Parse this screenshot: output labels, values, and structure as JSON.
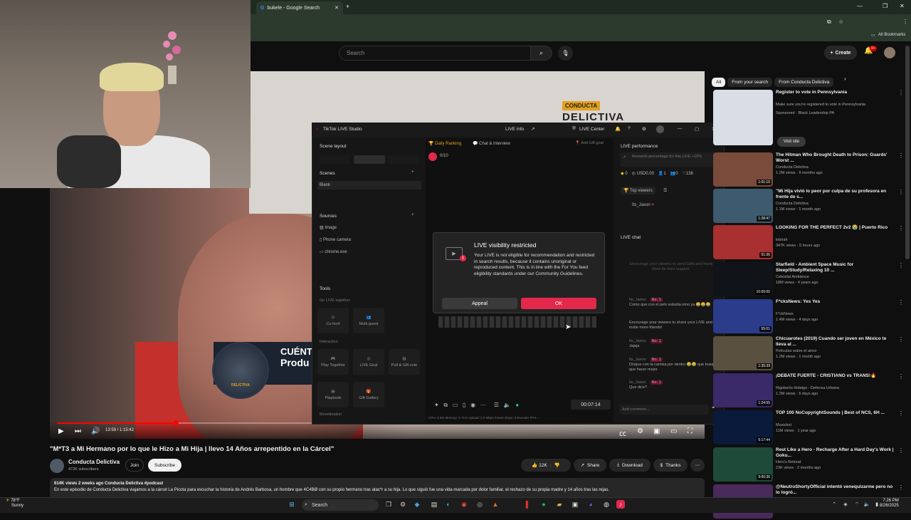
{
  "browser": {
    "tab_title": "bukele - Google Search",
    "bookmarks_label": "All Bookmarks"
  },
  "youtube": {
    "search_placeholder": "Search",
    "create_label": "Create",
    "notif_count": "9+",
    "video": {
      "time": "13:59 / 1:15:42",
      "progress_fraction": 0.185,
      "logo_top": "CONDUCTA",
      "logo_main": "DELICTIVA",
      "lower_third_1": "CUÉNT",
      "lower_third_2": "Produ",
      "badge": "DELICTIVA"
    },
    "title": "\"M*T3 a Mi Hermano por lo que le Hizo a Mi Hija | llevo 14 Años arrepentido en la Cárcel\"",
    "channel": {
      "name": "Conducta Delictiva",
      "subs": "472K subscribers"
    },
    "join_label": "Join",
    "subscribe_label": "Subscribe",
    "actions": {
      "likes": "12K",
      "share": "Share",
      "download": "Download",
      "thanks": "Thanks"
    },
    "description": {
      "meta": "614K views  2 weeks ago  Conducta Delictiva #podcast",
      "text": "En este episodio de Conducta Delictiva viajamos a la cárcel La Picota para escuchar la historia de Andrés Barbosa, un hombre que 4C4BØ con su propio hermano tras atac*r a su hija. Lo que siguió fue una vida marcada por dolor familiar, el rechazo de su propia madre y 14 años tras las rejas."
    },
    "chips": [
      "All",
      "From your search",
      "From Conducta Delictiva"
    ],
    "recommendations": [
      {
        "title": "Register to vote in Pennsylvania",
        "channel": "Make sure you're registered to vote in Pennsylvania",
        "meta": "Sponsored · Black Leadership PA",
        "duration": "",
        "cta": "Visit site",
        "color": "#d8dde6"
      },
      {
        "title": "The Hitman Who Brought Death to Prison: Guards' Worst ...",
        "channel": "Conducta Delictiva",
        "meta": "1.2M views · 9 months ago",
        "duration": "1:01:16",
        "color": "#7a4a3a"
      },
      {
        "title": "\"Mi Hija vivió lo peor por culpa de su profesora en frente de s...",
        "channel": "Conducta Delictiva",
        "meta": "1.1M views · 1 month ago",
        "duration": "1:28:47",
        "color": "#3d5a6e"
      },
      {
        "title": "LOOKING FOR THE PERFECT 2v2 😭 | Puerto Rico",
        "channel": "lebriah",
        "meta": "347K views · 5 hours ago",
        "duration": "51:36",
        "color": "#a83030"
      },
      {
        "title": "Starfield - Ambient Space Music for Sleep/Study/Relaxing 10 ...",
        "channel": "Celestial Ambience",
        "meta": "18M views · 4 years ago",
        "duration": "10:00:00",
        "color": "#101418"
      },
      {
        "title": "F*cksNews: Yes Yes",
        "channel": "F*ckNews",
        "meta": "1.4M views · 4 days ago",
        "duration": "55:01",
        "color": "#2a3c8a"
      },
      {
        "title": "Chicuarotes (2019)  Cuando ser joven en México te lleva al ...",
        "channel": "Películas sobre el amor",
        "meta": "1.2M views · 1 month ago",
        "duration": "1:35:39",
        "color": "#5a5040"
      },
      {
        "title": "¡DEBATE FUERTE - CRISTIANO vs TRANS!🔥",
        "channel": "Rigoberto Hidalgo - Defensa Urbana",
        "meta": "1.2M views · 5 days ago",
        "duration": "1:24:55",
        "color": "#3a2a6a"
      },
      {
        "title": "TOP 100 NoCopyrightSounds | Best of NCS, 6H ...",
        "channel": "Musicbot",
        "meta": "11M views · 1 year ago",
        "duration": "6:17:44",
        "color": "#0a1a3a"
      },
      {
        "title": "Rest Like a Hero - Recharge After a Hard Day's Work | Goku...",
        "channel": "Hero's Retreat",
        "meta": "23K views · 2 months ago",
        "duration": "9:00:36",
        "color": "#1e4a3a"
      },
      {
        "title": "@NeutroShortyOfficial intentó venequizarme pero no lo logró...",
        "channel": "",
        "meta": "",
        "duration": "",
        "color": "#4a2a5a"
      }
    ]
  },
  "tiktok": {
    "window_title": "TikTok LIVE Studio",
    "live_info": "LIVE info",
    "live_center": "LIVE Center",
    "scene_layout": "Scene layout",
    "scenes": "Scenes",
    "scene_blank": "Blank",
    "sources": "Sources",
    "source_items": [
      "Image",
      "Phone camera",
      "chrome.exe"
    ],
    "tools": "Tools",
    "go_live_together": "Go LIVE together",
    "cohost": "Co-host",
    "multiguest": "Multi-guest",
    "interaction": "Interaction",
    "play_together": "Play Together",
    "live_goal": "LIVE Goal",
    "poll": "Poll & Gift vote",
    "playbook": "Playbook",
    "gift_gallery": "Gift Gallery",
    "monetization": "Monetization",
    "daily_ranking": "Daily Ranking",
    "chat_interview": "Chat & interview",
    "add_gift_goal": "Add Gift goal",
    "goal_counter": "0/10",
    "timer": "00:07:14",
    "stats_line": "CPU: 3.5%   Memory: 0.71%   Upload: 2.0 Mbps   Frame drops: 0   Encoder FPS: --",
    "live_performance": "LIVE performance",
    "rewards_text": "Rewards percentage for this LIVE +10%",
    "stat_diamonds": "0",
    "stat_usd": "USD0.00",
    "stat_viewers": "1",
    "stat_likes_a": "0",
    "stat_hearts": "136",
    "top_viewers": "Top viewers",
    "top_viewer_name": "Its_Jaxon",
    "live_chat": "LIVE chat",
    "chat_empty": "Encourage your viewers to send Gifts and thank them for their support.",
    "chat_messages": [
      {
        "user": "Its_Jaxon",
        "badge": "No. 1",
        "text": "Como que con el pelo estudia omo ya 😂😂😂"
      },
      {
        "user": "",
        "badge": "",
        "text": "Encourage your viewers to share your LIVE and invite more friends!"
      },
      {
        "user": "Its_Jaxon",
        "badge": "No. 1",
        "text": "Jajaja"
      },
      {
        "user": "Its_Jaxon",
        "badge": "No. 1",
        "text": "Dísque con la camisa por dentro 😂😂 que busquen que hacer mejor"
      },
      {
        "user": "Its_Jaxon",
        "badge": "No. 1",
        "text": "Que dice?"
      }
    ],
    "add_comment": "Add comment...",
    "dialog": {
      "title": "LIVE visibility restricted",
      "body": "Your LIVE is not eligible for recommendation and restricted in search results, because it contains unoriginal or reproduced content. This is in line with the For You feed eligibility standards under our Community Guidelines.",
      "appeal": "Appeal",
      "ok": "OK"
    }
  },
  "taskbar": {
    "temp": "78°F",
    "weather": "Sunny",
    "search": "Search",
    "time": "7:26 PM",
    "date": "8/26/2025"
  }
}
